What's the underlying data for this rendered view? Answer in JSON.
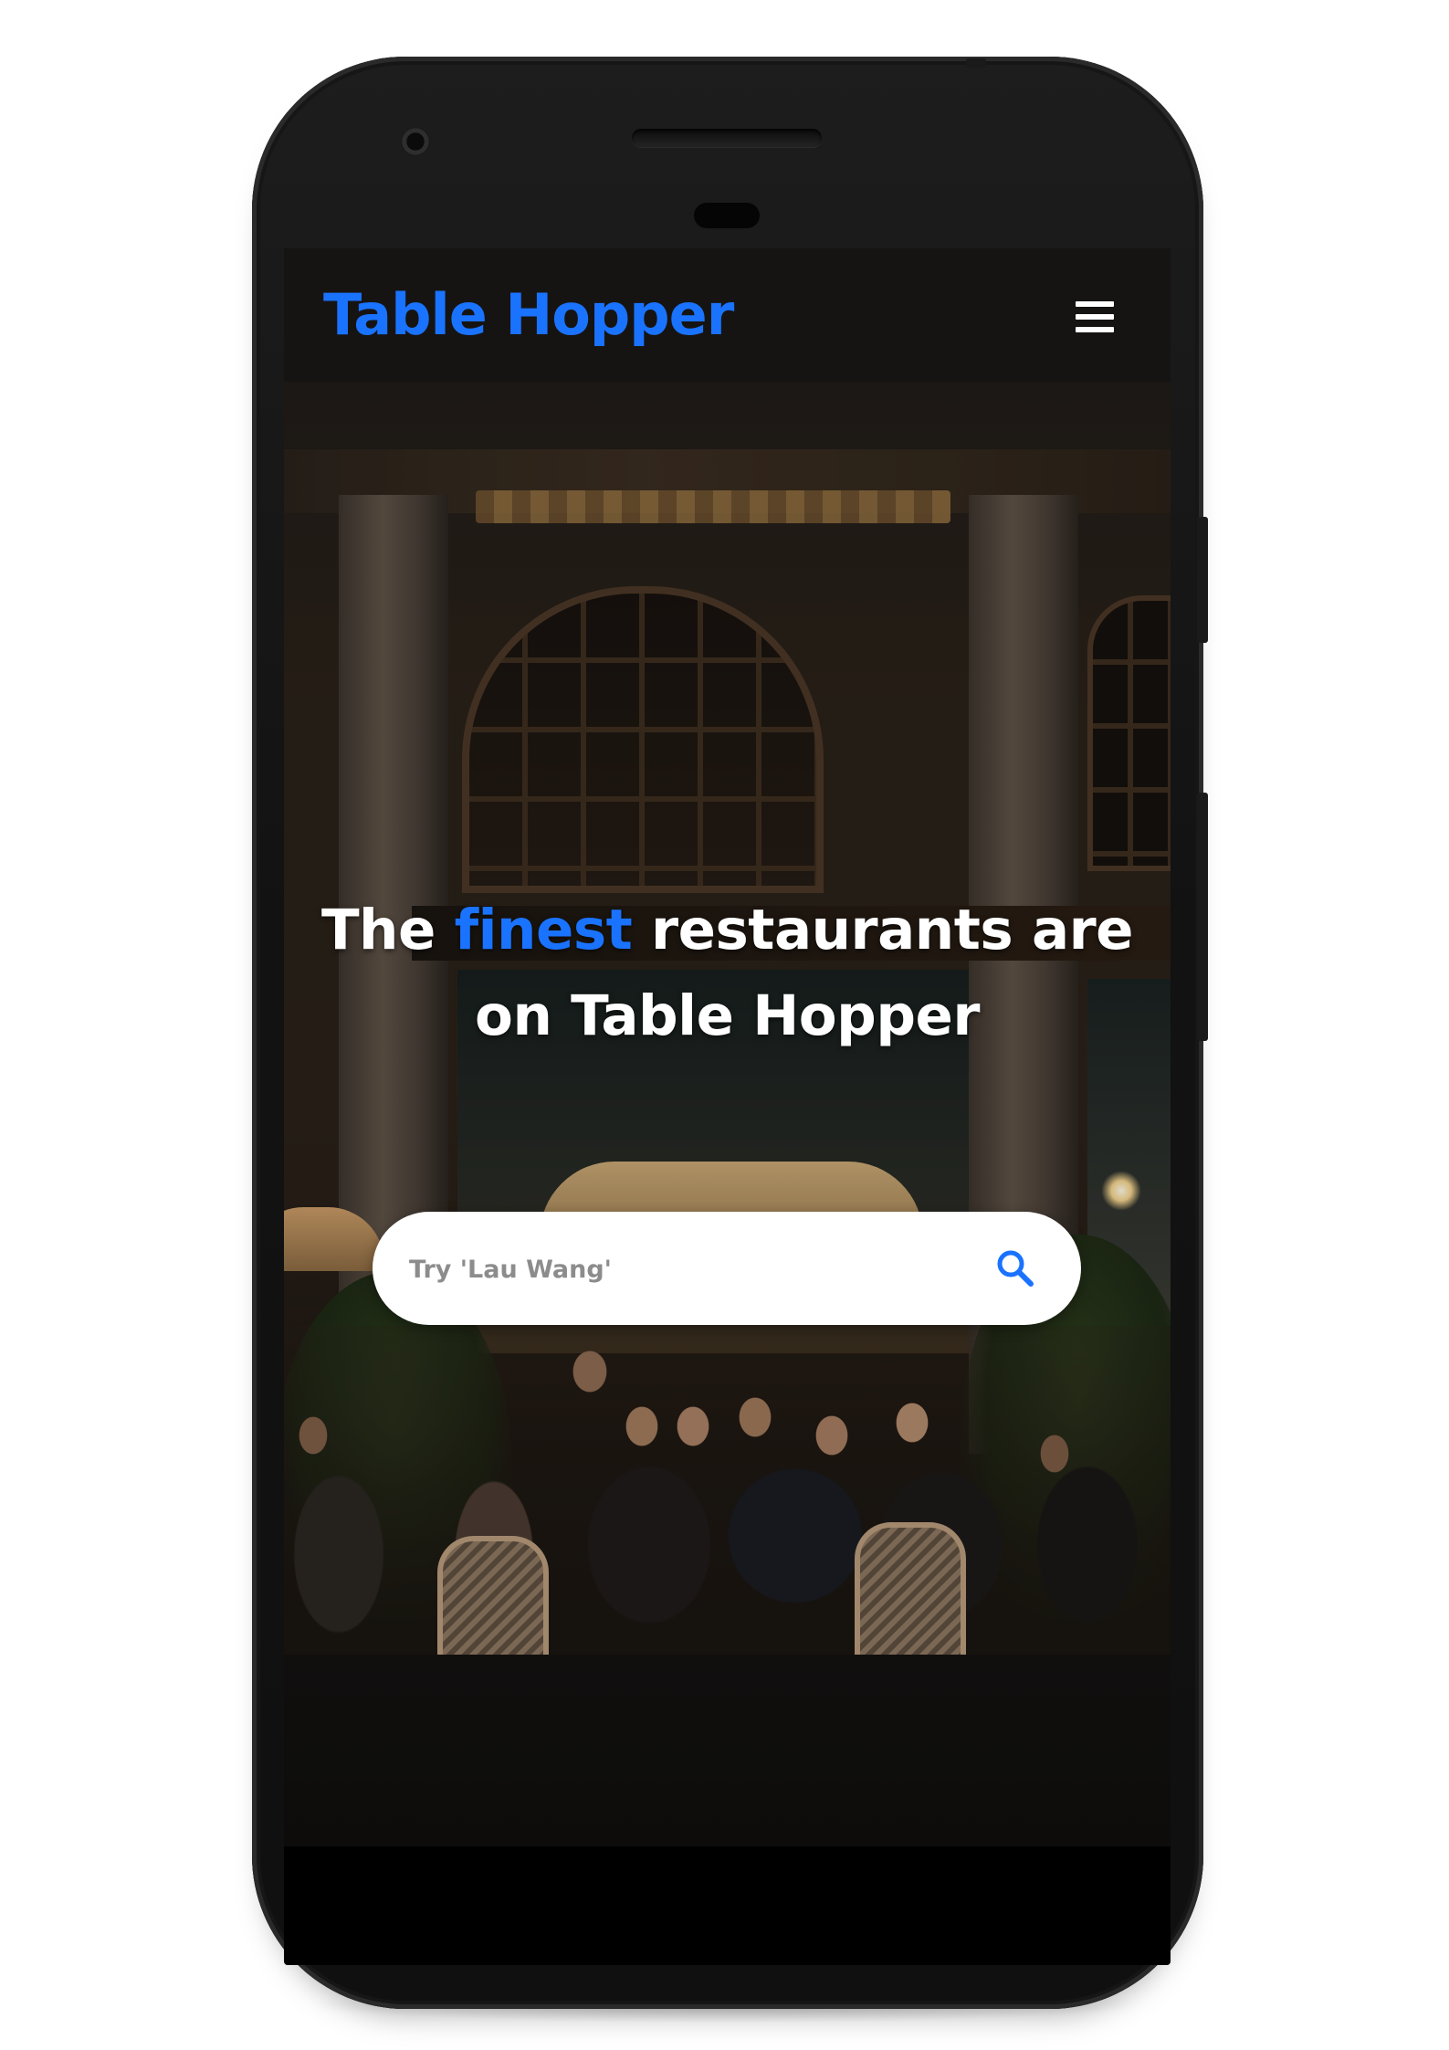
{
  "app": {
    "brand": "Table Hopper"
  },
  "hero": {
    "headline_before": "The ",
    "headline_accent": "finest",
    "headline_after": " restaurants are on Table Hopper"
  },
  "search": {
    "placeholder": "Try 'Lau Wang'",
    "value": ""
  },
  "icons": {
    "menu": "hamburger-menu-icon",
    "search": "search-icon"
  },
  "colors": {
    "accent": "#1a73ff",
    "navbar_bg": "#161514",
    "text": "#ffffff",
    "search_bg": "#ffffff"
  }
}
